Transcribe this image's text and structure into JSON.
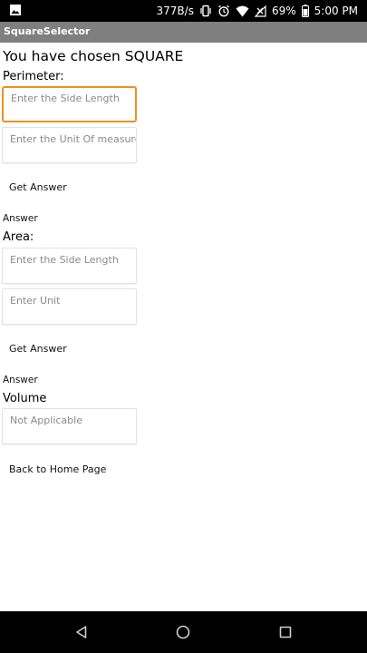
{
  "status_bar": {
    "network_speed": "377B/s",
    "battery_percent": "69%",
    "time": "5:00 PM",
    "icons": [
      "image-icon",
      "vibrate-icon",
      "alarm-icon",
      "wifi-icon",
      "no-signal-icon",
      "battery-icon"
    ]
  },
  "app_bar": {
    "title": "SquareSelector"
  },
  "main": {
    "heading": "You have chosen SQUARE",
    "perimeter": {
      "label": "Perimeter:",
      "side_placeholder": "Enter the Side Length",
      "unit_placeholder": "Enter the Unit Of measurement",
      "button_label": "Get Answer",
      "answer": "Answer"
    },
    "area": {
      "label": "Area:",
      "side_placeholder": "Enter the Side Length",
      "unit_placeholder": "Enter Unit",
      "button_label": "Get Answer",
      "answer": "Answer"
    },
    "volume": {
      "label": "Volume",
      "placeholder": "Not Applicable"
    },
    "back_button_label": "Back to Home Page"
  },
  "nav_bar": {
    "buttons": [
      "back-icon",
      "home-icon",
      "recents-icon"
    ]
  },
  "colors": {
    "status_bar": "#000000",
    "app_bar": "#7f7f7f",
    "focus_border": "#f0901d",
    "nav_bar": "#000000"
  }
}
